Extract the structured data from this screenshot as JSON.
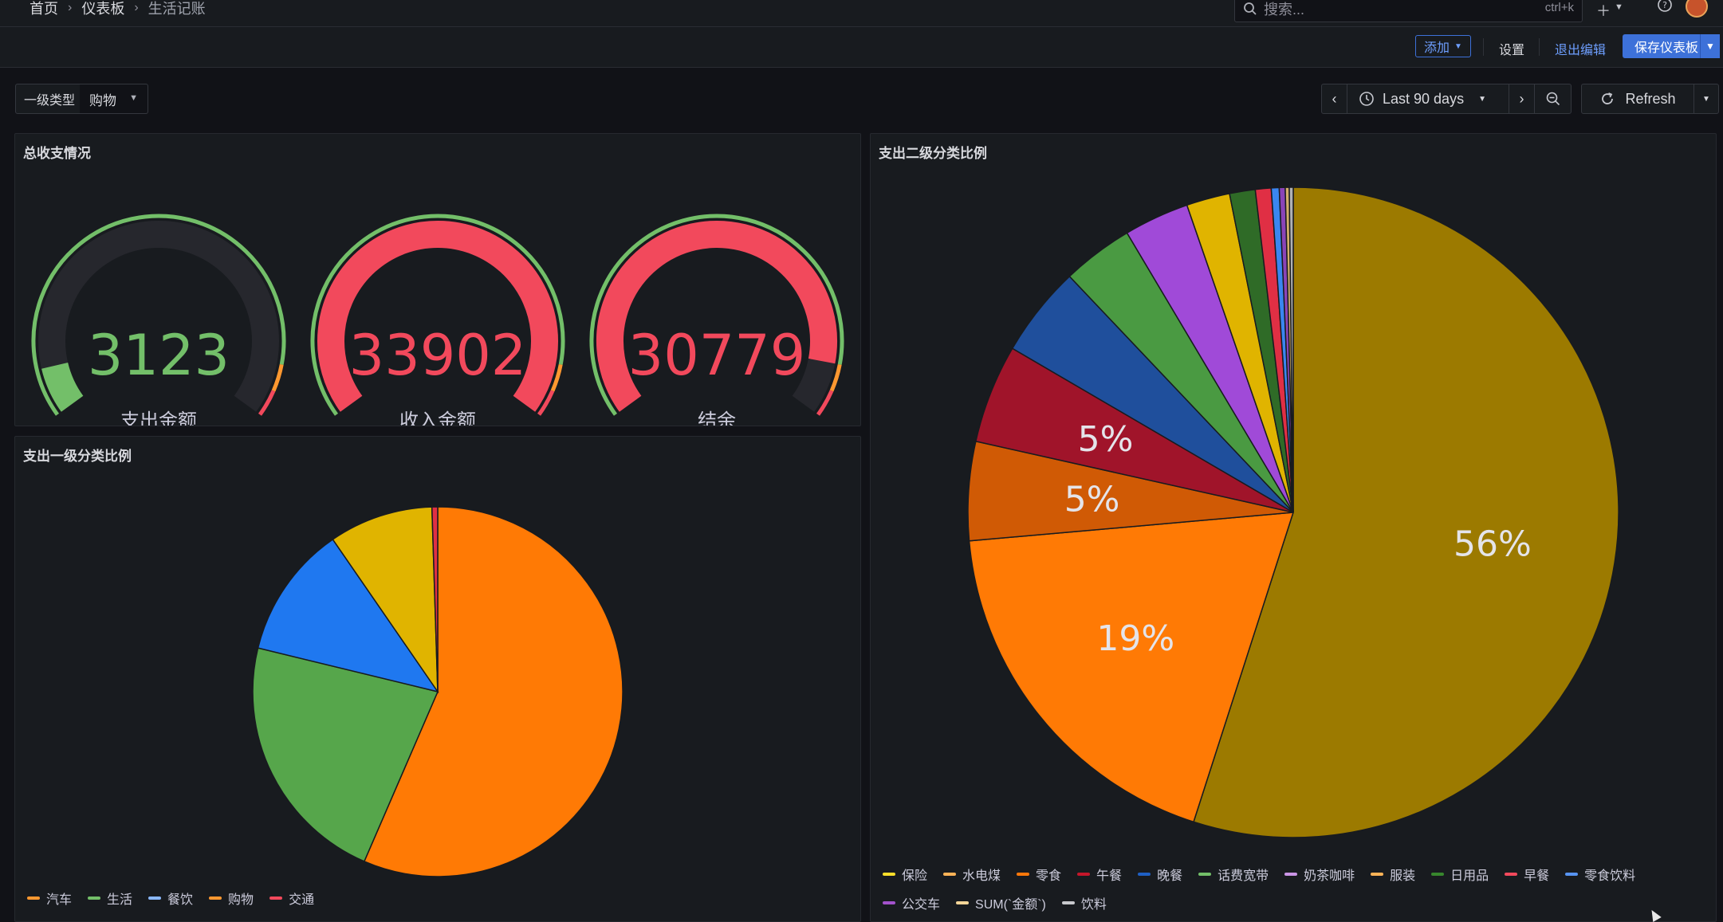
{
  "breadcrumb": {
    "home": "首页",
    "dashboards": "仪表板",
    "current": "生活记账"
  },
  "topbar": {
    "search_placeholder": "搜索...",
    "search_shortcut": "ctrl+k"
  },
  "editbar": {
    "add_label": "添加",
    "settings_label": "设置",
    "exit_label": "退出编辑",
    "save_label": "保存仪表板"
  },
  "variable": {
    "label": "一级类型",
    "value": "购物"
  },
  "timepicker": {
    "range": "Last 90 days",
    "refresh_label": "Refresh"
  },
  "panels": {
    "totals": {
      "title": "总收支情况",
      "gauges": [
        {
          "label": "支出金额",
          "value": "3123",
          "fraction": 0.09,
          "color": "#73bf69"
        },
        {
          "label": "收入金额",
          "value": "33902",
          "fraction": 1.0,
          "color": "#f2495c"
        },
        {
          "label": "结余",
          "value": "30779",
          "fraction": 0.9,
          "color": "#f2495c"
        }
      ]
    },
    "level1": {
      "title": "支出一级分类比例",
      "legend": [
        {
          "label": "汽车",
          "color": "#ff9830"
        },
        {
          "label": "生活",
          "color": "#73bf69"
        },
        {
          "label": "餐饮",
          "color": "#8ab8ff"
        },
        {
          "label": "购物",
          "color": "#ff9830"
        },
        {
          "label": "交通",
          "color": "#f2495c"
        }
      ]
    },
    "level2": {
      "title": "支出二级分类比例",
      "legend": [
        {
          "label": "保险",
          "color": "#fade2a"
        },
        {
          "label": "水电煤",
          "color": "#ffb357"
        },
        {
          "label": "零食",
          "color": "#ff780a"
        },
        {
          "label": "午餐",
          "color": "#c4162a"
        },
        {
          "label": "晚餐",
          "color": "#1f60c4"
        },
        {
          "label": "话费宽带",
          "color": "#73bf69"
        },
        {
          "label": "奶茶咖啡",
          "color": "#ca95e5"
        },
        {
          "label": "服装",
          "color": "#ffb357"
        },
        {
          "label": "日用品",
          "color": "#37872d"
        },
        {
          "label": "早餐",
          "color": "#f2495c"
        },
        {
          "label": "零食饮料",
          "color": "#5794f2"
        },
        {
          "label": "公交车",
          "color": "#a352cc"
        },
        {
          "label": "SUM(`金额`)",
          "color": "#f4d598"
        },
        {
          "label": "饮料",
          "color": "#c8c9cd"
        }
      ]
    }
  },
  "chart_data": [
    {
      "type": "pie",
      "title": "支出一级分类比例",
      "categories": [
        "汽车",
        "生活",
        "餐饮",
        "购物",
        "交通"
      ],
      "values": [
        56.5,
        22.3,
        11.6,
        9.1,
        0.5
      ],
      "colors": [
        "#ff7a05",
        "#56a64b",
        "#1f78f0",
        "#e0b400",
        "#e02f44"
      ]
    },
    {
      "type": "pie",
      "title": "支出二级分类比例",
      "categories": [
        "保险",
        "零食",
        "水电煤",
        "午餐",
        "晚餐",
        "话费宽带",
        "奶茶咖啡",
        "服装",
        "日用品",
        "早餐",
        "零食饮料",
        "公交车",
        "SUM(`金额`)",
        "饮料"
      ],
      "values": [
        56,
        19,
        5,
        5,
        4.6,
        3.6,
        3.3,
        2.2,
        1.3,
        0.8,
        0.4,
        0.3,
        0.2,
        0.2
      ],
      "colors": [
        "#9c7a00",
        "#ff7a05",
        "#d05a05",
        "#a0142a",
        "#1f4f9c",
        "#4a9a42",
        "#a04ad8",
        "#e0b400",
        "#2f6b27",
        "#e02f44",
        "#3a86f0",
        "#8a44b8",
        "#d4b06a",
        "#b0b1b5"
      ],
      "data_labels": [
        "56%",
        "19%",
        "5%",
        "5%"
      ]
    }
  ]
}
